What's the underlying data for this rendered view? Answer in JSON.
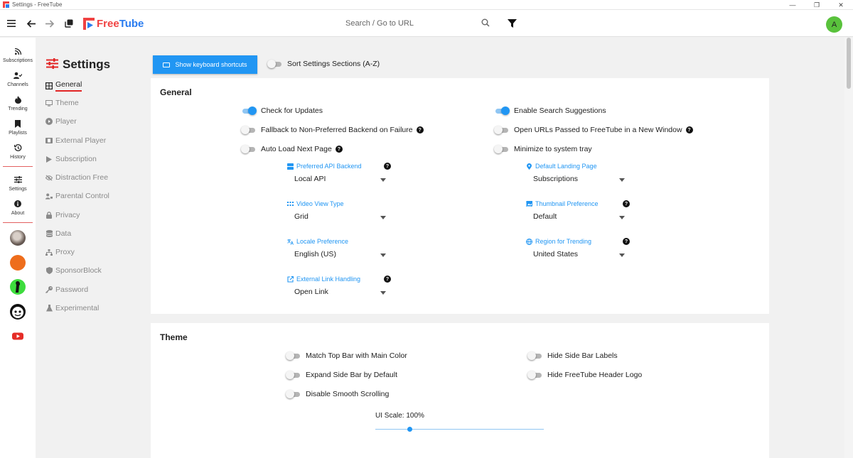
{
  "window": {
    "title": "Settings - FreeTube",
    "minimize": "—",
    "restore": "❐",
    "close": "✕"
  },
  "topbar": {
    "logo_free": "Free",
    "logo_tube": "Tube",
    "search_placeholder": "Search / Go to URL",
    "avatar_letter": "A"
  },
  "sidenav": {
    "items": [
      {
        "label": "Subscriptions",
        "icon": "rss-icon"
      },
      {
        "label": "Channels",
        "icon": "users-icon"
      },
      {
        "label": "Trending",
        "icon": "fire-icon"
      },
      {
        "label": "Playlists",
        "icon": "bookmark-icon"
      },
      {
        "label": "History",
        "icon": "history-icon"
      },
      {
        "label": "Settings",
        "icon": "sliders-icon"
      },
      {
        "label": "About",
        "icon": "info-icon"
      }
    ]
  },
  "settings_menu": {
    "heading": "Settings",
    "items": [
      {
        "label": "General"
      },
      {
        "label": "Theme"
      },
      {
        "label": "Player"
      },
      {
        "label": "External Player"
      },
      {
        "label": "Subscription"
      },
      {
        "label": "Distraction Free"
      },
      {
        "label": "Parental Control"
      },
      {
        "label": "Privacy"
      },
      {
        "label": "Data"
      },
      {
        "label": "Proxy"
      },
      {
        "label": "SponsorBlock"
      },
      {
        "label": "Password"
      },
      {
        "label": "Experimental"
      }
    ]
  },
  "content": {
    "keyboard_button": "Show keyboard shortcuts",
    "sort_toggle": {
      "label": "Sort Settings Sections (A-Z)",
      "on": false
    },
    "general": {
      "title": "General",
      "toggles_left": [
        {
          "label": "Check for Updates",
          "on": true,
          "help": false
        },
        {
          "label": "Fallback to Non-Preferred Backend on Failure",
          "on": false,
          "help": true
        },
        {
          "label": "Auto Load Next Page",
          "on": false,
          "help": true
        }
      ],
      "toggles_right": [
        {
          "label": "Enable Search Suggestions",
          "on": true,
          "help": false
        },
        {
          "label": "Open URLs Passed to FreeTube in a New Window",
          "on": false,
          "help": true
        },
        {
          "label": "Minimize to system tray",
          "on": false,
          "help": false
        }
      ],
      "selects_left": [
        {
          "label": "Preferred API Backend",
          "value": "Local API",
          "icon": "server-icon",
          "help": true
        },
        {
          "label": "Video View Type",
          "value": "Grid",
          "icon": "grid-icon",
          "help": false
        },
        {
          "label": "Locale Preference",
          "value": "English (US)",
          "icon": "language-icon",
          "help": false
        },
        {
          "label": "External Link Handling",
          "value": "Open Link",
          "icon": "external-link-icon",
          "help": true
        }
      ],
      "selects_right": [
        {
          "label": "Default Landing Page",
          "value": "Subscriptions",
          "icon": "location-pin-icon",
          "help": false
        },
        {
          "label": "Thumbnail Preference",
          "value": "Default",
          "icon": "image-icon",
          "help": true
        },
        {
          "label": "Region for Trending",
          "value": "United States",
          "icon": "globe-icon",
          "help": true
        }
      ]
    },
    "theme": {
      "title": "Theme",
      "toggles_left": [
        {
          "label": "Match Top Bar with Main Color",
          "on": false
        },
        {
          "label": "Expand Side Bar by Default",
          "on": false
        },
        {
          "label": "Disable Smooth Scrolling",
          "on": false
        }
      ],
      "toggles_right": [
        {
          "label": "Hide Side Bar Labels",
          "on": false
        },
        {
          "label": "Hide FreeTube Header Logo",
          "on": false
        }
      ],
      "ui_scale_label": "UI Scale: 100%",
      "ui_scale_level": 0.2
    }
  },
  "help_glyph": "?",
  "colors": {
    "accent": "#2196f3",
    "brand_red": "#f04242",
    "brand_blue": "#2a7cf0",
    "avatar": "#59c23c"
  }
}
